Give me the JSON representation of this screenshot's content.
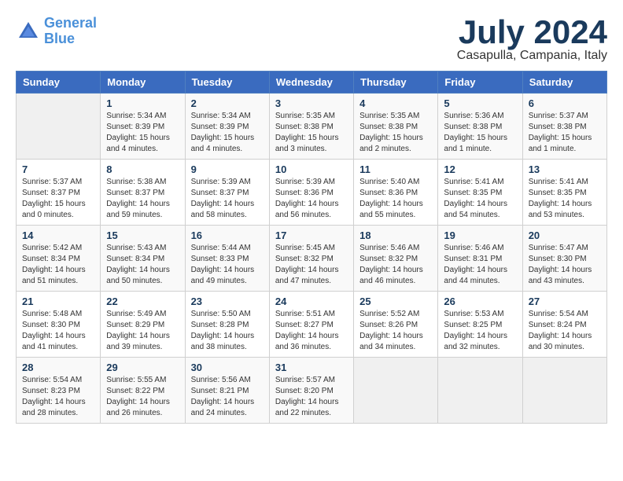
{
  "header": {
    "logo_line1": "General",
    "logo_line2": "Blue",
    "month_year": "July 2024",
    "location": "Casapulla, Campania, Italy"
  },
  "days_of_week": [
    "Sunday",
    "Monday",
    "Tuesday",
    "Wednesday",
    "Thursday",
    "Friday",
    "Saturday"
  ],
  "weeks": [
    [
      {
        "day": "",
        "sunrise": "",
        "sunset": "",
        "daylight": ""
      },
      {
        "day": "1",
        "sunrise": "Sunrise: 5:34 AM",
        "sunset": "Sunset: 8:39 PM",
        "daylight": "Daylight: 15 hours and 4 minutes."
      },
      {
        "day": "2",
        "sunrise": "Sunrise: 5:34 AM",
        "sunset": "Sunset: 8:39 PM",
        "daylight": "Daylight: 15 hours and 4 minutes."
      },
      {
        "day": "3",
        "sunrise": "Sunrise: 5:35 AM",
        "sunset": "Sunset: 8:38 PM",
        "daylight": "Daylight: 15 hours and 3 minutes."
      },
      {
        "day": "4",
        "sunrise": "Sunrise: 5:35 AM",
        "sunset": "Sunset: 8:38 PM",
        "daylight": "Daylight: 15 hours and 2 minutes."
      },
      {
        "day": "5",
        "sunrise": "Sunrise: 5:36 AM",
        "sunset": "Sunset: 8:38 PM",
        "daylight": "Daylight: 15 hours and 1 minute."
      },
      {
        "day": "6",
        "sunrise": "Sunrise: 5:37 AM",
        "sunset": "Sunset: 8:38 PM",
        "daylight": "Daylight: 15 hours and 1 minute."
      }
    ],
    [
      {
        "day": "7",
        "sunrise": "Sunrise: 5:37 AM",
        "sunset": "Sunset: 8:37 PM",
        "daylight": "Daylight: 15 hours and 0 minutes."
      },
      {
        "day": "8",
        "sunrise": "Sunrise: 5:38 AM",
        "sunset": "Sunset: 8:37 PM",
        "daylight": "Daylight: 14 hours and 59 minutes."
      },
      {
        "day": "9",
        "sunrise": "Sunrise: 5:39 AM",
        "sunset": "Sunset: 8:37 PM",
        "daylight": "Daylight: 14 hours and 58 minutes."
      },
      {
        "day": "10",
        "sunrise": "Sunrise: 5:39 AM",
        "sunset": "Sunset: 8:36 PM",
        "daylight": "Daylight: 14 hours and 56 minutes."
      },
      {
        "day": "11",
        "sunrise": "Sunrise: 5:40 AM",
        "sunset": "Sunset: 8:36 PM",
        "daylight": "Daylight: 14 hours and 55 minutes."
      },
      {
        "day": "12",
        "sunrise": "Sunrise: 5:41 AM",
        "sunset": "Sunset: 8:35 PM",
        "daylight": "Daylight: 14 hours and 54 minutes."
      },
      {
        "day": "13",
        "sunrise": "Sunrise: 5:41 AM",
        "sunset": "Sunset: 8:35 PM",
        "daylight": "Daylight: 14 hours and 53 minutes."
      }
    ],
    [
      {
        "day": "14",
        "sunrise": "Sunrise: 5:42 AM",
        "sunset": "Sunset: 8:34 PM",
        "daylight": "Daylight: 14 hours and 51 minutes."
      },
      {
        "day": "15",
        "sunrise": "Sunrise: 5:43 AM",
        "sunset": "Sunset: 8:34 PM",
        "daylight": "Daylight: 14 hours and 50 minutes."
      },
      {
        "day": "16",
        "sunrise": "Sunrise: 5:44 AM",
        "sunset": "Sunset: 8:33 PM",
        "daylight": "Daylight: 14 hours and 49 minutes."
      },
      {
        "day": "17",
        "sunrise": "Sunrise: 5:45 AM",
        "sunset": "Sunset: 8:32 PM",
        "daylight": "Daylight: 14 hours and 47 minutes."
      },
      {
        "day": "18",
        "sunrise": "Sunrise: 5:46 AM",
        "sunset": "Sunset: 8:32 PM",
        "daylight": "Daylight: 14 hours and 46 minutes."
      },
      {
        "day": "19",
        "sunrise": "Sunrise: 5:46 AM",
        "sunset": "Sunset: 8:31 PM",
        "daylight": "Daylight: 14 hours and 44 minutes."
      },
      {
        "day": "20",
        "sunrise": "Sunrise: 5:47 AM",
        "sunset": "Sunset: 8:30 PM",
        "daylight": "Daylight: 14 hours and 43 minutes."
      }
    ],
    [
      {
        "day": "21",
        "sunrise": "Sunrise: 5:48 AM",
        "sunset": "Sunset: 8:30 PM",
        "daylight": "Daylight: 14 hours and 41 minutes."
      },
      {
        "day": "22",
        "sunrise": "Sunrise: 5:49 AM",
        "sunset": "Sunset: 8:29 PM",
        "daylight": "Daylight: 14 hours and 39 minutes."
      },
      {
        "day": "23",
        "sunrise": "Sunrise: 5:50 AM",
        "sunset": "Sunset: 8:28 PM",
        "daylight": "Daylight: 14 hours and 38 minutes."
      },
      {
        "day": "24",
        "sunrise": "Sunrise: 5:51 AM",
        "sunset": "Sunset: 8:27 PM",
        "daylight": "Daylight: 14 hours and 36 minutes."
      },
      {
        "day": "25",
        "sunrise": "Sunrise: 5:52 AM",
        "sunset": "Sunset: 8:26 PM",
        "daylight": "Daylight: 14 hours and 34 minutes."
      },
      {
        "day": "26",
        "sunrise": "Sunrise: 5:53 AM",
        "sunset": "Sunset: 8:25 PM",
        "daylight": "Daylight: 14 hours and 32 minutes."
      },
      {
        "day": "27",
        "sunrise": "Sunrise: 5:54 AM",
        "sunset": "Sunset: 8:24 PM",
        "daylight": "Daylight: 14 hours and 30 minutes."
      }
    ],
    [
      {
        "day": "28",
        "sunrise": "Sunrise: 5:54 AM",
        "sunset": "Sunset: 8:23 PM",
        "daylight": "Daylight: 14 hours and 28 minutes."
      },
      {
        "day": "29",
        "sunrise": "Sunrise: 5:55 AM",
        "sunset": "Sunset: 8:22 PM",
        "daylight": "Daylight: 14 hours and 26 minutes."
      },
      {
        "day": "30",
        "sunrise": "Sunrise: 5:56 AM",
        "sunset": "Sunset: 8:21 PM",
        "daylight": "Daylight: 14 hours and 24 minutes."
      },
      {
        "day": "31",
        "sunrise": "Sunrise: 5:57 AM",
        "sunset": "Sunset: 8:20 PM",
        "daylight": "Daylight: 14 hours and 22 minutes."
      },
      {
        "day": "",
        "sunrise": "",
        "sunset": "",
        "daylight": ""
      },
      {
        "day": "",
        "sunrise": "",
        "sunset": "",
        "daylight": ""
      },
      {
        "day": "",
        "sunrise": "",
        "sunset": "",
        "daylight": ""
      }
    ]
  ]
}
